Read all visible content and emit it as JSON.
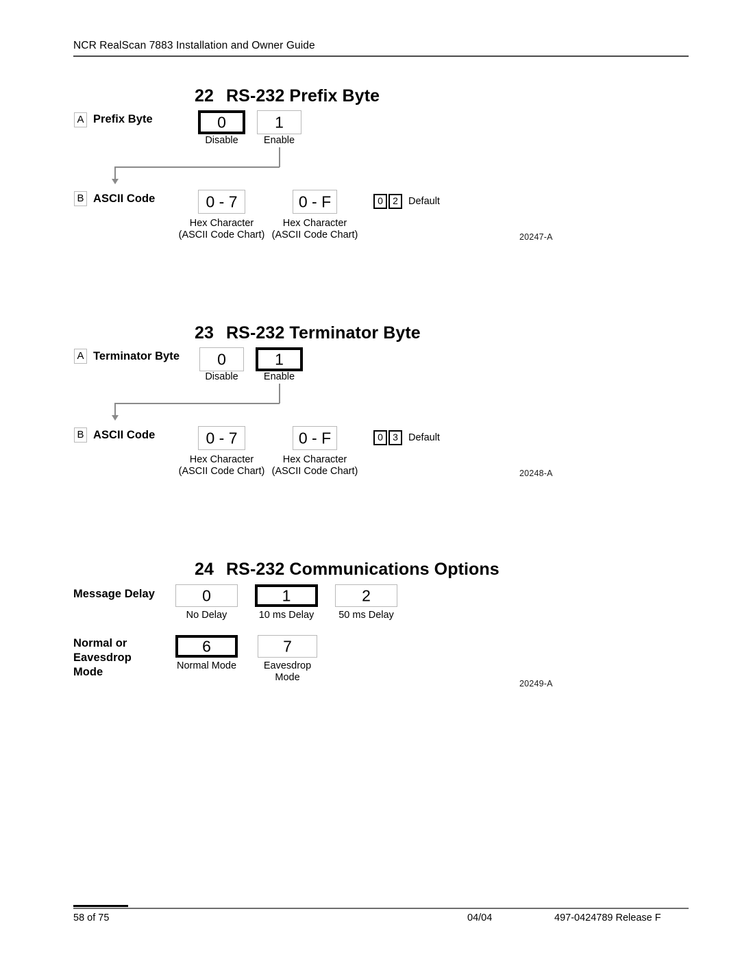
{
  "document": {
    "header_title": "NCR RealScan 7883 Installation and Owner Guide",
    "footer": {
      "page": "58 of 75",
      "date": "04/04",
      "part_release": "497-0424789  Release F"
    }
  },
  "sections": [
    {
      "number": "22",
      "title": "RS-232 Prefix Byte",
      "drawing_id": "20247-A",
      "rows": [
        {
          "badge": "A",
          "label": "Prefix Byte",
          "options": [
            {
              "value": "0",
              "caption": "Disable",
              "selected": true
            },
            {
              "value": "1",
              "caption": "Enable",
              "selected": false
            }
          ],
          "defaults": [],
          "default_label": ""
        },
        {
          "badge": "B",
          "label": "ASCII Code",
          "options": [
            {
              "value": "0 - 7",
              "caption": "Hex Character\n(ASCII Code Chart)",
              "selected": false
            },
            {
              "value": "0 - F",
              "caption": "Hex Character\n(ASCII Code Chart)",
              "selected": false
            }
          ],
          "defaults": [
            "0",
            "2"
          ],
          "default_label": "Default"
        }
      ]
    },
    {
      "number": "23",
      "title": "RS-232 Terminator Byte",
      "drawing_id": "20248-A",
      "rows": [
        {
          "badge": "A",
          "label": "Terminator Byte",
          "options": [
            {
              "value": "0",
              "caption": "Disable",
              "selected": false
            },
            {
              "value": "1",
              "caption": "Enable",
              "selected": true
            }
          ],
          "defaults": [],
          "default_label": ""
        },
        {
          "badge": "B",
          "label": "ASCII Code",
          "options": [
            {
              "value": "0 - 7",
              "caption": "Hex Character\n(ASCII Code Chart)",
              "selected": false
            },
            {
              "value": "0 - F",
              "caption": "Hex Character\n(ASCII Code Chart)",
              "selected": false
            }
          ],
          "defaults": [
            "0",
            "3"
          ],
          "default_label": "Default"
        }
      ]
    },
    {
      "number": "24",
      "title": "RS-232 Communications Options",
      "drawing_id": "20249-A",
      "rows": [
        {
          "badge": "",
          "label": "Message Delay",
          "options": [
            {
              "value": "0",
              "caption": "No Delay",
              "selected": false
            },
            {
              "value": "1",
              "caption": "10 ms Delay",
              "selected": true
            },
            {
              "value": "2",
              "caption": "50 ms Delay",
              "selected": false
            }
          ],
          "defaults": [],
          "default_label": ""
        },
        {
          "badge": "",
          "label": "Normal or\nEavesdrop\nMode",
          "options": [
            {
              "value": "6",
              "caption": "Normal Mode",
              "selected": true
            },
            {
              "value": "7",
              "caption": "Eavesdrop\nMode",
              "selected": false
            }
          ],
          "defaults": [],
          "default_label": ""
        }
      ]
    }
  ]
}
